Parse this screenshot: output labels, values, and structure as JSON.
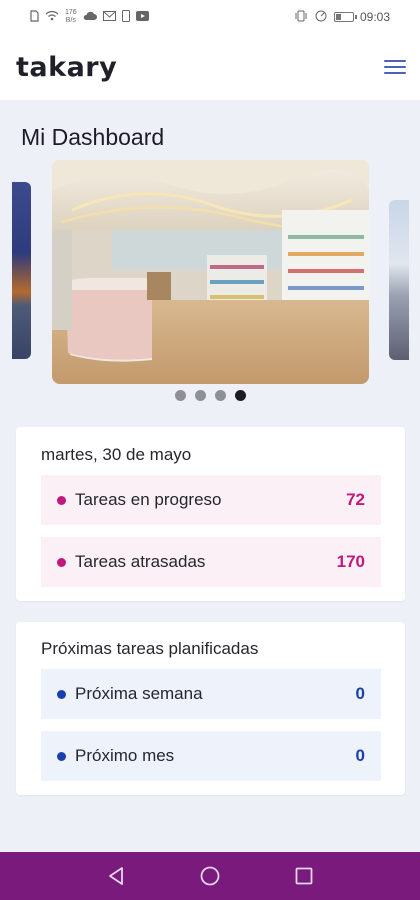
{
  "status_bar": {
    "speed_top": "176",
    "speed_bottom": "B/s",
    "time": "09:03",
    "battery_level": 0.3
  },
  "header": {
    "logo": "takary"
  },
  "page": {
    "title": "Mi Dashboard"
  },
  "carousel": {
    "slides": 4,
    "active_index": 3
  },
  "today_card": {
    "date": "martes, 30 de mayo",
    "items": [
      {
        "label": "Tareas en progreso",
        "count": "72",
        "color": "#c2187a",
        "bg": "#fbf0f6"
      },
      {
        "label": "Tareas atrasadas",
        "count": "170",
        "color": "#c2187a",
        "bg": "#fbf0f6"
      }
    ]
  },
  "planned_card": {
    "title": "Próximas tareas planificadas",
    "items": [
      {
        "label": "Próxima semana",
        "count": "0",
        "color": "#1a3fae",
        "bg": "#eef2fa"
      },
      {
        "label": "Próximo mes",
        "count": "0",
        "color": "#1a3fae",
        "bg": "#eef2fa"
      }
    ]
  },
  "colors": {
    "nav_bar": "#7a1a7c",
    "page_bg": "#eef0f8",
    "menu_accent": "#4a63b8"
  },
  "icons": {
    "back": "back-triangle-icon",
    "home": "home-circle-icon",
    "recents": "recents-square-icon"
  }
}
